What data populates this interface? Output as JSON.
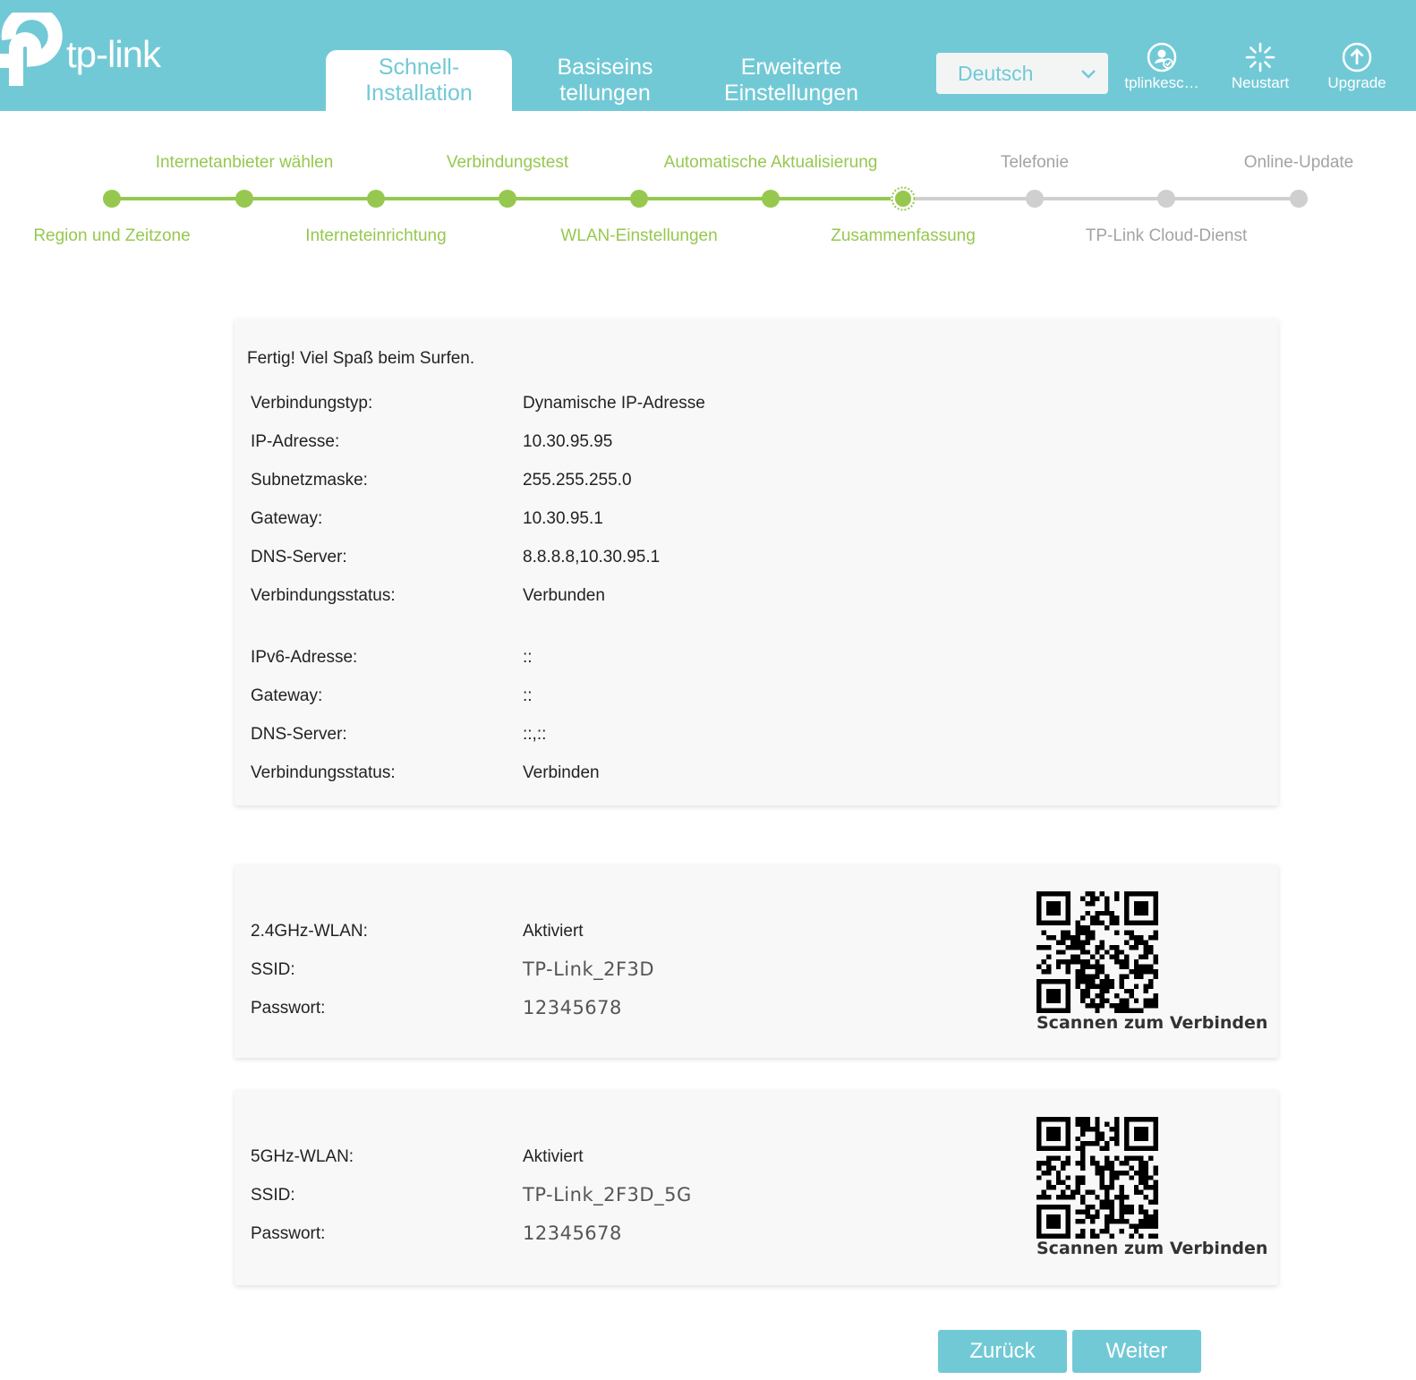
{
  "header": {
    "brand": "tp-link",
    "tabs": [
      {
        "label": "Schnell-Installation",
        "active": true
      },
      {
        "label": "Basiseinstellungen",
        "active": false
      },
      {
        "label": "Erweiterte Einstellungen",
        "active": false
      }
    ],
    "language": "Deutsch",
    "account_label": "tplinkesc…",
    "reboot_label": "Neustart",
    "upgrade_label": "Upgrade",
    "accent_color": "#72c9d6"
  },
  "steps": {
    "completed_color": "#96c84f",
    "pending_color": "#a3a3a3",
    "current_index": 6,
    "items": [
      {
        "label": "Region und Zeitzone",
        "status": "done"
      },
      {
        "label": "Internetanbieter wählen",
        "status": "done"
      },
      {
        "label": "Interneteinrichtung",
        "status": "done"
      },
      {
        "label": "Verbindungstest",
        "status": "done"
      },
      {
        "label": "WLAN-Einstellungen",
        "status": "done"
      },
      {
        "label": "Automatische Aktualisierung",
        "status": "done"
      },
      {
        "label": "Zusammenfassung",
        "status": "current"
      },
      {
        "label": "Telefonie",
        "status": "pending"
      },
      {
        "label": "TP-Link Cloud-Dienst",
        "status": "pending"
      },
      {
        "label": "Online-Update",
        "status": "pending"
      }
    ]
  },
  "summary": {
    "intro": "Fertig! Viel Spaß beim Surfen.",
    "ipv4": [
      {
        "label": "Verbindungstyp:",
        "value": "Dynamische IP-Adresse"
      },
      {
        "label": "IP-Adresse:",
        "value": "10.30.95.95"
      },
      {
        "label": "Subnetzmaske:",
        "value": "255.255.255.0"
      },
      {
        "label": "Gateway:",
        "value": "10.30.95.1"
      },
      {
        "label": "DNS-Server:",
        "value": "8.8.8.8,10.30.95.1"
      },
      {
        "label": "Verbindungsstatus:",
        "value": "Verbunden"
      }
    ],
    "ipv6": [
      {
        "label": "IPv6-Adresse:",
        "value": "::"
      },
      {
        "label": "Gateway:",
        "value": "::"
      },
      {
        "label": "DNS-Server:",
        "value": "::,::"
      },
      {
        "label": "Verbindungsstatus:",
        "value": "Verbinden"
      }
    ]
  },
  "wlan_24": {
    "rows": [
      {
        "label": "2.4GHz-WLAN:",
        "value": "Aktiviert"
      },
      {
        "label": "SSID:",
        "value": "TP-Link_2F3D"
      },
      {
        "label": "Passwort:",
        "value": "12345678"
      }
    ],
    "qr_caption": "Scannen zum Verbinden"
  },
  "wlan_5": {
    "rows": [
      {
        "label": "5GHz-WLAN:",
        "value": "Aktiviert"
      },
      {
        "label": "SSID:",
        "value": "TP-Link_2F3D_5G"
      },
      {
        "label": "Passwort:",
        "value": "12345678"
      }
    ],
    "qr_caption": "Scannen zum Verbinden"
  },
  "buttons": {
    "back": "Zurück",
    "next": "Weiter"
  }
}
